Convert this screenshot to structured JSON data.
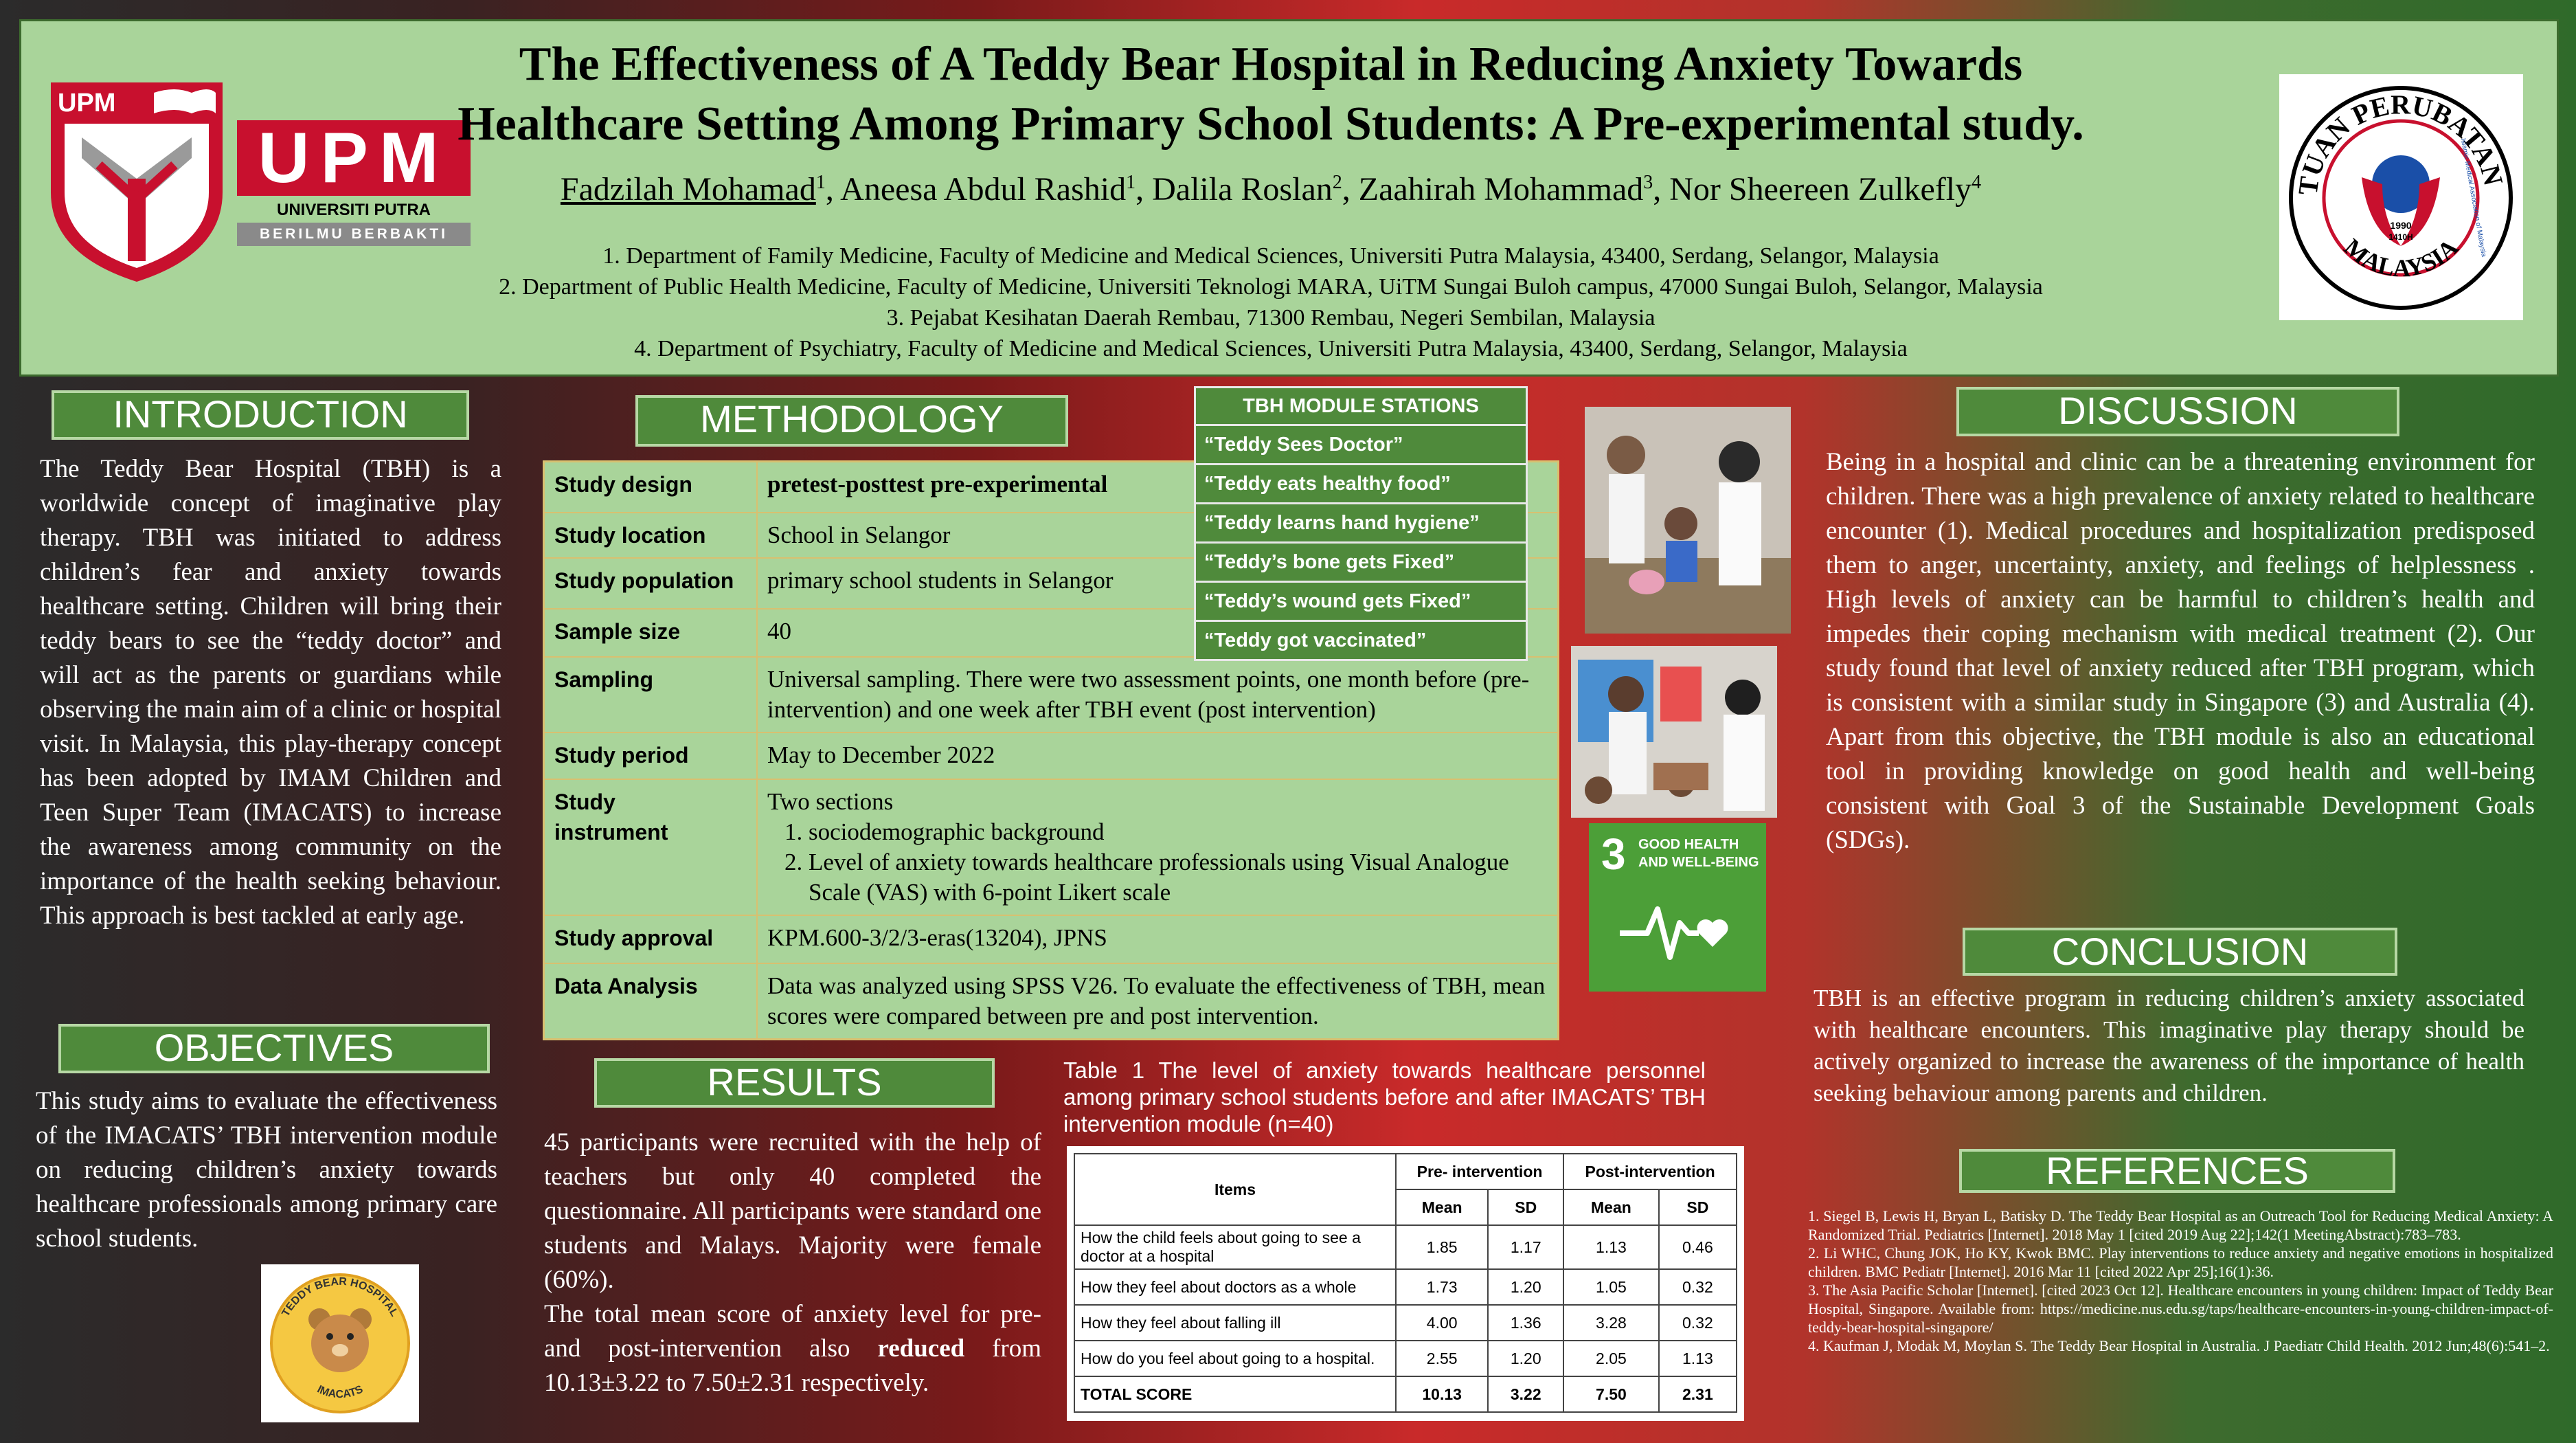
{
  "header": {
    "title_line1": "The Effectiveness of A Teddy Bear Hospital in Reducing Anxiety Towards",
    "title_line2": "Healthcare Setting Among Primary School Students: A Pre-experimental study.",
    "authors": [
      {
        "name": "Fadzilah Mohamad",
        "sup": "1"
      },
      {
        "name": "Aneesa Abdul Rashid",
        "sup": "1"
      },
      {
        "name": "Dalila Roslan",
        "sup": "2"
      },
      {
        "name": "Zaahirah Mohammad",
        "sup": "3"
      },
      {
        "name": "Nor Sheereen Zulkefly",
        "sup": "4"
      }
    ],
    "affiliations": [
      "1.      Department of Family Medicine, Faculty of Medicine and Medical Sciences, Universiti Putra Malaysia, 43400, Serdang, Selangor, Malaysia",
      "2.      Department of Public Health Medicine, Faculty of Medicine, Universiti Teknologi MARA, UiTM Sungai Buloh campus,  47000 Sungai Buloh, Selangor, Malaysia",
      "3.      Pejabat Kesihatan Daerah Rembau, 71300 Rembau, Negeri Sembilan, Malaysia",
      "4.      Department of Psychiatry, Faculty of Medicine and Medical Sciences, Universiti Putra Malaysia, 43400, Serdang, Selangor, Malaysia"
    ]
  },
  "logos": {
    "upm_badge": "UPM",
    "upm_word": "UPM",
    "upm_name": "UNIVERSITI PUTRA MALAYSIA",
    "upm_motto": "BERILMU BERBAKTI",
    "imam_ring_top": "PERSATUAN PERUBATAN ISLAM",
    "imam_ring_bottom": "MALAYSIA",
    "imam_inner": "Islamic Medical Association of Malaysia",
    "imam_year": "1990",
    "imam_hijri": "1410H",
    "imacats_top": "TEDDY BEAR HOSPITAL",
    "imacats_bottom": "IMACATS"
  },
  "introduction": {
    "heading": "INTRODUCTION",
    "text": "The Teddy Bear Hospital (TBH) is a worldwide concept of imaginative play therapy. TBH was initiated to address children’s fear and anxiety towards healthcare setting. Children will bring their teddy bears to see the “teddy doctor” and will act as the parents or guardians while observing the main aim of a clinic or hospital visit. In Malaysia, this play-therapy concept has been adopted by IMAM Children and Teen Super Team (IMACATS) to increase the awareness among community on the importance of the health seeking behaviour. This approach is best tackled at early age."
  },
  "objectives": {
    "heading": "OBJECTIVES",
    "text": "This study aims to evaluate the effectiveness of the IMACATS’ TBH intervention module on reducing children’s anxiety towards healthcare professionals among primary care school students."
  },
  "methodology": {
    "heading": "METHODOLOGY",
    "rows": {
      "design": {
        "label": "Study design",
        "value": "pretest-posttest pre-experimental"
      },
      "location": {
        "label": "Study location",
        "value": "School in Selangor"
      },
      "population": {
        "label": "Study population",
        "value": "primary school students in Selangor"
      },
      "sample": {
        "label": "Sample size",
        "value": "40"
      },
      "sampling": {
        "label": "Sampling",
        "value": "Universal sampling. There were two assessment points, one month before (pre-intervention) and one week after TBH event (post intervention)"
      },
      "period": {
        "label": "Study period",
        "value": "May to December 2022"
      },
      "instrument": {
        "label_line1": "Study",
        "label_line2": "instrument",
        "value": "Two sections",
        "item1": "sociodemographic background",
        "item2": "Level of anxiety towards healthcare professionals using Visual Analogue Scale (VAS) with 6-point Likert scale"
      },
      "approval": {
        "label": "Study approval",
        "value": "KPM.600-3/2/3-eras(13204), JPNS"
      },
      "analysis": {
        "label": "Data Analysis",
        "value": "Data was analyzed using SPSS V26. To evaluate the effectiveness of TBH, mean scores were compared between pre and post intervention."
      }
    }
  },
  "stations": {
    "heading": "TBH MODULE STATIONS",
    "items": [
      "“Teddy Sees Doctor”",
      "“Teddy eats healthy food”",
      "“Teddy learns hand hygiene”",
      "“Teddy’s bone gets Fixed”",
      "“Teddy’s wound gets Fixed”",
      "“Teddy got vaccinated”"
    ]
  },
  "sdg": {
    "number": "3",
    "line1": "GOOD HEALTH",
    "line2": "AND WELL-BEING"
  },
  "results": {
    "heading": "RESULTS",
    "text_part1": "45 participants were recruited with the help of teachers but only 40 completed the questionnaire. All participants were standard one students and Malays. Majority were female (60%).",
    "text_part2": "The total mean score of anxiety level for pre- and post-intervention also",
    "text_bold": "reduced",
    "text_part3": "from 10.13±3.22 to 7.50±2.31 respectively."
  },
  "table1": {
    "caption": "Table 1 The level of anxiety towards healthcare personnel among primary school students before and after IMACATS’ TBH intervention module (n=40)",
    "col_items": "Items",
    "col_pre": "Pre- intervention",
    "col_post": "Post-intervention",
    "col_mean": "Mean",
    "col_sd": "SD",
    "rows": [
      {
        "item": "How the child feels about going to see a doctor at a hospital",
        "pre_mean": "1.85",
        "pre_sd": "1.17",
        "post_mean": "1.13",
        "post_sd": "0.46"
      },
      {
        "item": "How they feel about doctors as a whole",
        "pre_mean": "1.73",
        "pre_sd": "1.20",
        "post_mean": "1.05",
        "post_sd": "0.32"
      },
      {
        "item": "How they feel about falling ill",
        "pre_mean": "4.00",
        "pre_sd": "1.36",
        "post_mean": "3.28",
        "post_sd": "0.32"
      },
      {
        "item": "How do you feel about going to a hospital.",
        "pre_mean": "2.55",
        "pre_sd": "1.20",
        "post_mean": "2.05",
        "post_sd": "1.13"
      },
      {
        "item": "TOTAL SCORE",
        "pre_mean": "10.13",
        "pre_sd": "3.22",
        "post_mean": "7.50",
        "post_sd": "2.31"
      }
    ]
  },
  "discussion": {
    "heading": "DISCUSSION",
    "text": "Being in a hospital and clinic can be a threatening environment for children. There was a high prevalence of anxiety related to healthcare encounter (1). Medical procedures and hospitalization predisposed them to anger, uncertainty, anxiety, and feelings of helplessness . High levels of anxiety can be harmful to children’s health and impedes their coping mechanism with medical treatment (2). Our study found that level of anxiety reduced after TBH program, which is consistent with a similar study in Singapore (3) and Australia (4). Apart from this objective, the TBH module is also an educational tool in providing knowledge on good health and well-being consistent with Goal 3 of the Sustainable Development Goals (SDGs)."
  },
  "conclusion": {
    "heading": "CONCLUSION",
    "text": "TBH is an effective program in reducing children’s anxiety associated with healthcare encounters. This imaginative play therapy should be actively organized to increase the awareness of the importance of health seeking behaviour among parents and children."
  },
  "references": {
    "heading": "REFERENCES",
    "items": [
      "1.        Siegel B, Lewis H, Bryan L, Batisky D. The Teddy Bear Hospital as an Outreach Tool for Reducing Medical Anxiety: A Randomized Trial. Pediatrics [Internet]. 2018 May 1 [cited 2019 Aug 22];142(1 MeetingAbstract):783–783.",
      "2.        Li WHC, Chung JOK, Ho KY, Kwok BMC. Play interventions to reduce anxiety and negative emotions in hospitalized children. BMC Pediatr [Internet]. 2016 Mar 11 [cited 2022 Apr 25];16(1):36.",
      "3.        The Asia Pacific Scholar [Internet]. [cited 2023 Oct 12]. Healthcare encounters in young children: Impact of Teddy Bear Hospital, Singapore. Available from: https://medicine.nus.edu.sg/taps/healthcare-encounters-in-young-children-impact-of-teddy-bear-hospital-singapore/",
      "4.        Kaufman J, Modak M, Moylan S. The Teddy Bear Hospital in Australia. J Paediatr Child Health. 2012 Jun;48(6):541–2."
    ]
  }
}
